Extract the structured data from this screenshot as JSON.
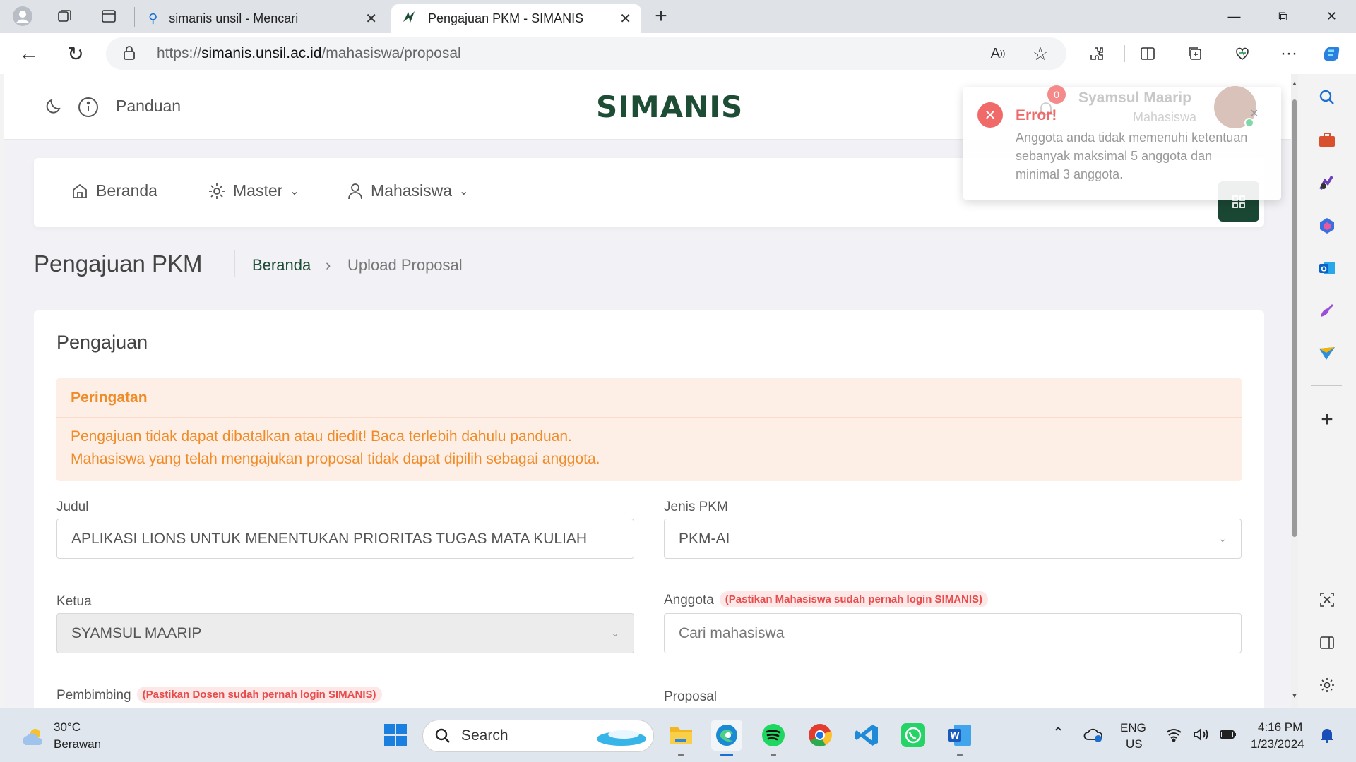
{
  "browser": {
    "tabs": [
      {
        "title": "simanis unsil - Mencari"
      },
      {
        "title": "Pengajuan PKM - SIMANIS"
      }
    ],
    "url_prefix": "https://",
    "url_host": "simanis.unsil.ac.id",
    "url_path": "/mahasiswa/proposal"
  },
  "header": {
    "guide_label": "Panduan",
    "logo_text": "SIMANIS",
    "user_name": "Syamsul Maarip",
    "user_role": "Mahasiswa",
    "notification_count": "0"
  },
  "nav": {
    "home": "Beranda",
    "master": "Master",
    "student": "Mahasiswa"
  },
  "page": {
    "title": "Pengajuan PKM",
    "breadcrumb_home": "Beranda",
    "breadcrumb_sep": "›",
    "breadcrumb_current": "Upload Proposal"
  },
  "form": {
    "card_title": "Pengajuan",
    "alert_title": "Peringatan",
    "alert_line1": "Pengajuan tidak dapat dibatalkan atau diedit! Baca terlebih dahulu panduan.",
    "alert_line2": "Mahasiswa yang telah mengajukan proposal tidak dapat dipilih sebagai anggota.",
    "judul_label": "Judul",
    "judul_value": "APLIKASI LIONS UNTUK MENENTUKAN PRIORITAS TUGAS MATA KULIAH",
    "jenis_label": "Jenis PKM",
    "jenis_value": "PKM-AI",
    "ketua_label": "Ketua",
    "ketua_value": "SYAMSUL MAARIP",
    "anggota_label": "Anggota",
    "anggota_badge": "(Pastikan Mahasiswa sudah pernah login SIMANIS)",
    "anggota_placeholder": "Cari mahasiswa",
    "pembimbing_label": "Pembimbing",
    "pembimbing_badge": "(Pastikan Dosen sudah pernah login SIMANIS)",
    "proposal_label": "Proposal"
  },
  "toast": {
    "title": "Error!",
    "message": "Anggota anda tidak memenuhi ketentuan sebanyak maksimal 5 anggota dan minimal 3 anggota.",
    "close": "×"
  },
  "taskbar": {
    "weather_temp": "30°C",
    "weather_desc": "Berawan",
    "search_label": "Search",
    "lang": "ENG",
    "region": "US",
    "time": "4:16 PM",
    "date": "1/23/2024"
  },
  "colors": {
    "brand_green": "#1a4733",
    "warning_orange": "#f08c28",
    "error_red": "#ee6a6a"
  }
}
